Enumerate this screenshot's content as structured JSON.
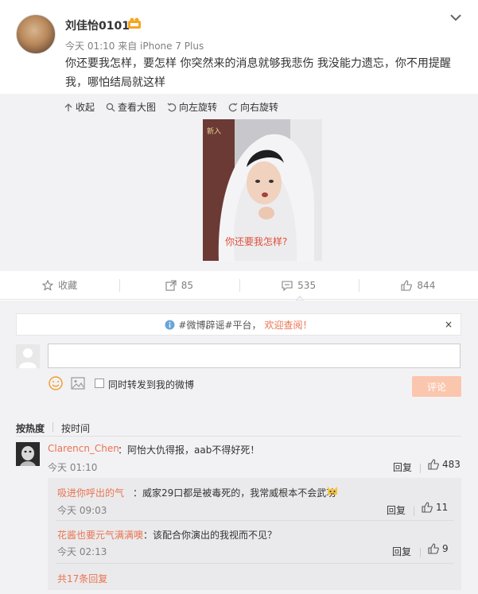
{
  "post": {
    "username": "刘佳怡0101",
    "meta": "今天 01:10 来自 iPhone 7 Plus",
    "text": "你还要我怎样，要怎样 你突然来的消息就够我悲伤 我没能力遗忘，你不用提醒我，哪怕结局就这样",
    "image_caption": "你还要我怎样?"
  },
  "media_toolbar": {
    "collapse": "收起",
    "view_large": "查看大图",
    "rotate_left": "向左旋转",
    "rotate_right": "向右旋转"
  },
  "actions": {
    "favorite": "收藏",
    "forward_count": "85",
    "comment_count": "535",
    "like_count": "844"
  },
  "notice": {
    "prefix": "#微博辟谣#平台，",
    "accent": "欢迎查阅！",
    "close": "×"
  },
  "composer": {
    "forward_label": "同时转发到我的微博",
    "submit_label": "评论"
  },
  "sort": {
    "hot": "按热度",
    "time": "按时间"
  },
  "comment": {
    "user": "Clarencn_Chen",
    "text": "：阿怡大仇得报，aab不得好死！",
    "time": "今天 01:10",
    "reply": "回复",
    "likes": "483"
  },
  "replies": [
    {
      "user": "吸进你呼出的气",
      "text": "：威家29口都是被毒死的，我常威根本不会武功",
      "time": "今天 09:03",
      "reply": "回复",
      "likes": "11"
    },
    {
      "user": "花酱也要元气满满噢",
      "text": "：该配合你演出的我视而不见？",
      "time": "今天 02:13",
      "reply": "回复",
      "likes": "9"
    }
  ],
  "more_replies": "共17条回复",
  "colors": {
    "accent": "#eb7350",
    "gray_bg": "#f2f2f5",
    "submit_bg": "#fbc6ae"
  }
}
